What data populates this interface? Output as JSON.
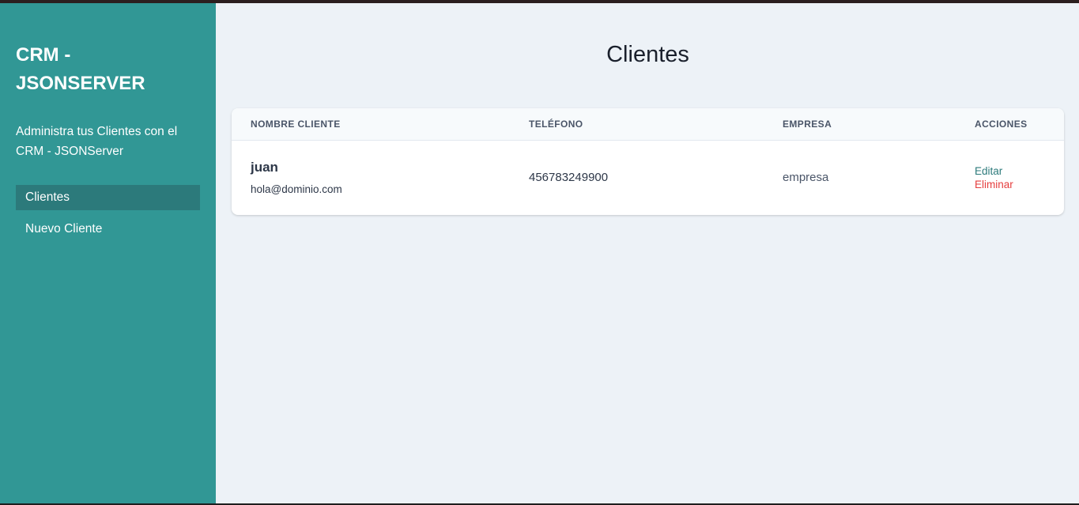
{
  "sidebar": {
    "brand": "CRM - JSONSERVER",
    "tagline": "Administra tus Clientes con el CRM - JSONServer",
    "nav": [
      {
        "label": "Clientes",
        "active": true
      },
      {
        "label": "Nuevo Cliente",
        "active": false
      }
    ]
  },
  "main": {
    "title": "Clientes",
    "table": {
      "headers": {
        "name": "NOMBRE CLIENTE",
        "phone": "TELÉFONO",
        "company": "EMPRESA",
        "actions": "ACCIONES"
      },
      "rows": [
        {
          "name": "juan",
          "email": "hola@dominio.com",
          "phone": "456783249900",
          "company": "empresa",
          "edit_label": "Editar",
          "delete_label": "Eliminar"
        }
      ]
    }
  },
  "colors": {
    "sidebar_bg": "#319795",
    "sidebar_active": "#2c7a7b",
    "main_bg": "#edf2f7",
    "edit": "#2c7a7b",
    "delete": "#e53e3e"
  }
}
